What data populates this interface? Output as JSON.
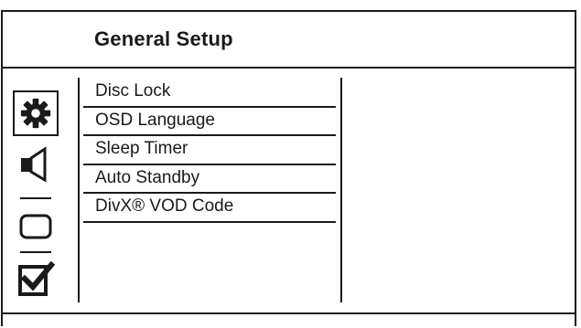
{
  "header": {
    "title": "General Setup"
  },
  "sidebar": {
    "items": [
      {
        "icon": "gear-icon",
        "selected": true
      },
      {
        "icon": "speaker-icon",
        "selected": false
      },
      {
        "icon": "display-icon",
        "selected": false
      },
      {
        "icon": "checkbox-checked-icon",
        "selected": false
      }
    ]
  },
  "menu": {
    "items": [
      {
        "label": "Disc Lock"
      },
      {
        "label": "OSD Language"
      },
      {
        "label": "Sleep Timer"
      },
      {
        "label": "Auto Standby"
      },
      {
        "label": "DivX® VOD Code"
      }
    ]
  },
  "colors": {
    "ink": "#1a1a1a",
    "background": "#ffffff"
  }
}
